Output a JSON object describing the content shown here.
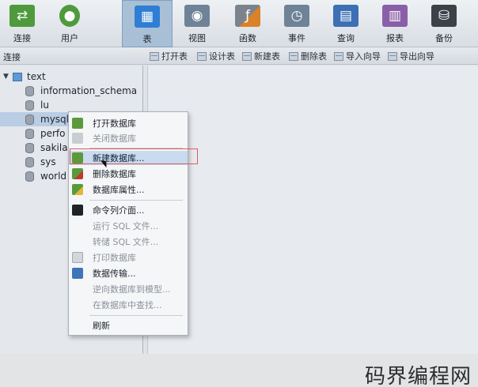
{
  "toolbar": {
    "items": [
      {
        "label": "连接",
        "icon": "connection-icon",
        "active": false
      },
      {
        "label": "用户",
        "icon": "user-icon",
        "active": false
      },
      {
        "label": "表",
        "icon": "table-icon",
        "active": true
      },
      {
        "label": "视图",
        "icon": "view-icon",
        "active": false
      },
      {
        "label": "函数",
        "icon": "function-icon",
        "active": false
      },
      {
        "label": "事件",
        "icon": "event-icon",
        "active": false
      },
      {
        "label": "查询",
        "icon": "query-icon",
        "active": false
      },
      {
        "label": "报表",
        "icon": "report-icon",
        "active": false
      },
      {
        "label": "备份",
        "icon": "backup-icon",
        "active": false
      }
    ]
  },
  "subbar": {
    "connections_label": "连接",
    "actions": [
      {
        "label": "打开表",
        "icon": "open-table-icon"
      },
      {
        "label": "设计表",
        "icon": "design-table-icon"
      },
      {
        "label": "新建表",
        "icon": "new-table-icon"
      },
      {
        "label": "删除表",
        "icon": "delete-table-icon"
      },
      {
        "label": "导入向导",
        "icon": "import-wizard-icon"
      },
      {
        "label": "导出向导",
        "icon": "export-wizard-icon"
      }
    ]
  },
  "tree": {
    "root": "text",
    "databases": [
      "information_schema",
      "lu",
      "mysql",
      "perfo",
      "sakila",
      "sys",
      "world"
    ],
    "selected": "mysql"
  },
  "context_menu": {
    "items": [
      {
        "label": "打开数据库",
        "icon": "open-database-icon",
        "enabled": true
      },
      {
        "label": "关闭数据库",
        "icon": "close-database-icon",
        "enabled": false
      },
      {
        "label": "新建数据库...",
        "icon": "new-database-icon",
        "enabled": true,
        "highlighted": true
      },
      {
        "label": "删除数据库",
        "icon": "delete-database-icon",
        "enabled": true
      },
      {
        "label": "数据库属性...",
        "icon": "database-properties-icon",
        "enabled": true
      },
      {
        "label": "命令列介面...",
        "icon": "terminal-icon",
        "enabled": true
      },
      {
        "label": "运行 SQL 文件...",
        "icon": "",
        "enabled": false
      },
      {
        "label": "转储 SQL 文件...",
        "icon": "",
        "enabled": false
      },
      {
        "label": "打印数据库",
        "icon": "printer-icon",
        "enabled": false
      },
      {
        "label": "数据传输...",
        "icon": "data-transfer-icon",
        "enabled": true
      },
      {
        "label": "逆向数据库到模型...",
        "icon": "",
        "enabled": false
      },
      {
        "label": "在数据库中查找...",
        "icon": "",
        "enabled": false
      },
      {
        "label": "刷新",
        "icon": "",
        "enabled": true
      }
    ]
  },
  "watermark": "码界编程网"
}
